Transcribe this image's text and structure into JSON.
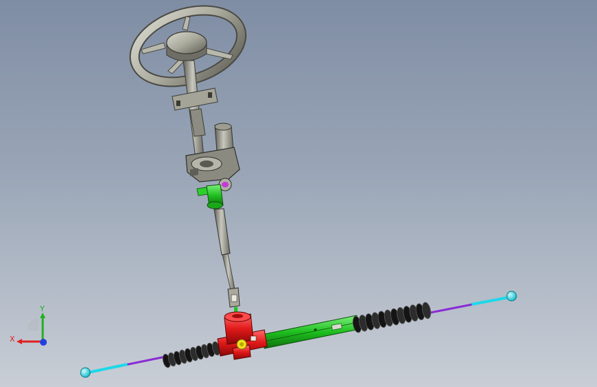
{
  "scene": {
    "description_hidden": "",
    "colors": {
      "background_top": "#7f8da4",
      "background_bottom": "#c9ced6",
      "metal": "#9a9a8c",
      "rack_housing": "#22c322",
      "pinion_block": "#e01818",
      "bellows": "#1e1e1e",
      "tie_rod": "#8a2bd6",
      "tie_rod_end": "#1ed8e8",
      "yellow_marker": "#f0e020"
    }
  },
  "triad": {
    "x_label": "X",
    "y_label": "Y",
    "x_color": "#e02020",
    "y_color": "#20b020",
    "z_color": "#2040e0"
  }
}
